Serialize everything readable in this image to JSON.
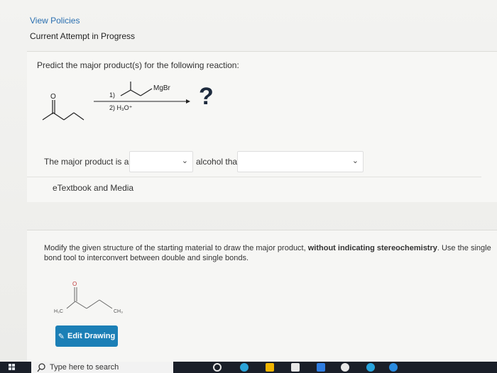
{
  "header": {
    "view_policies": "View Policies",
    "current_attempt": "Current Attempt in Progress"
  },
  "question": {
    "prompt": "Predict the major product(s) for the following reaction:",
    "reagent_label": "MgBr",
    "step1": "1)",
    "step2": "2) H₃O⁺",
    "unknown": "?"
  },
  "answer": {
    "prefix": "The major product is a",
    "middle": "alcohol that",
    "dropdown1_value": "",
    "dropdown2_value": ""
  },
  "etextbook": "eTextbook and Media",
  "part2": {
    "instruction_plain": "Modify the given structure of the starting material to draw the major product, ",
    "instruction_bold": "without indicating stereochemistry",
    "instruction_rest": ". Use the single bond tool to interconvert between double and single bonds.",
    "atom_o": "O",
    "atom_left": "H₃C",
    "atom_right": "CH₃",
    "edit_button": "Edit Drawing"
  },
  "taskbar": {
    "search_placeholder": "Type here to search"
  },
  "colors": {
    "link": "#2a6fb0",
    "button": "#1b7fb6",
    "taskbar": "#1a1f29"
  }
}
